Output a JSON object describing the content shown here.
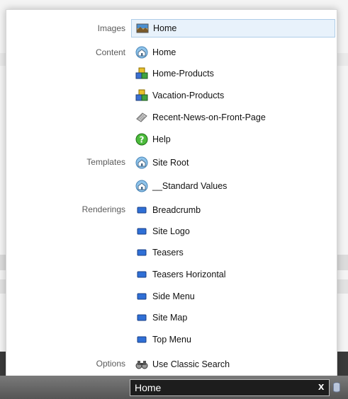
{
  "categories": {
    "images": "Images",
    "content": "Content",
    "templates": "Templates",
    "renderings": "Renderings",
    "options": "Options"
  },
  "results": {
    "images": [
      {
        "label": "Home",
        "icon": "image-icon",
        "selected": true
      }
    ],
    "content": [
      {
        "label": "Home",
        "icon": "home-icon"
      },
      {
        "label": "Home-Products",
        "icon": "products-icon"
      },
      {
        "label": "Vacation-Products",
        "icon": "products-icon"
      },
      {
        "label": "Recent-News-on-Front-Page",
        "icon": "news-icon"
      },
      {
        "label": "Help",
        "icon": "help-icon"
      }
    ],
    "templates": [
      {
        "label": "Site Root",
        "icon": "home-icon"
      },
      {
        "label": "__Standard Values",
        "icon": "home-icon"
      }
    ],
    "renderings": [
      {
        "label": "Breadcrumb",
        "icon": "rendering-icon"
      },
      {
        "label": "Site Logo",
        "icon": "rendering-icon"
      },
      {
        "label": "Teasers",
        "icon": "rendering-icon"
      },
      {
        "label": "Teasers Horizontal",
        "icon": "rendering-icon"
      },
      {
        "label": "Side Menu",
        "icon": "rendering-icon"
      },
      {
        "label": "Site Map",
        "icon": "rendering-icon"
      },
      {
        "label": "Top Menu",
        "icon": "rendering-icon"
      }
    ],
    "options": [
      {
        "label": "Use Classic Search",
        "icon": "binoculars-icon"
      }
    ]
  },
  "search": {
    "value": "Home",
    "clear_label": "x"
  },
  "colors": {
    "selected_bg": "#e8f2fb",
    "selected_border": "#aecde8",
    "category_text": "#5a5a5a",
    "search_bg": "#1d1d1d"
  }
}
